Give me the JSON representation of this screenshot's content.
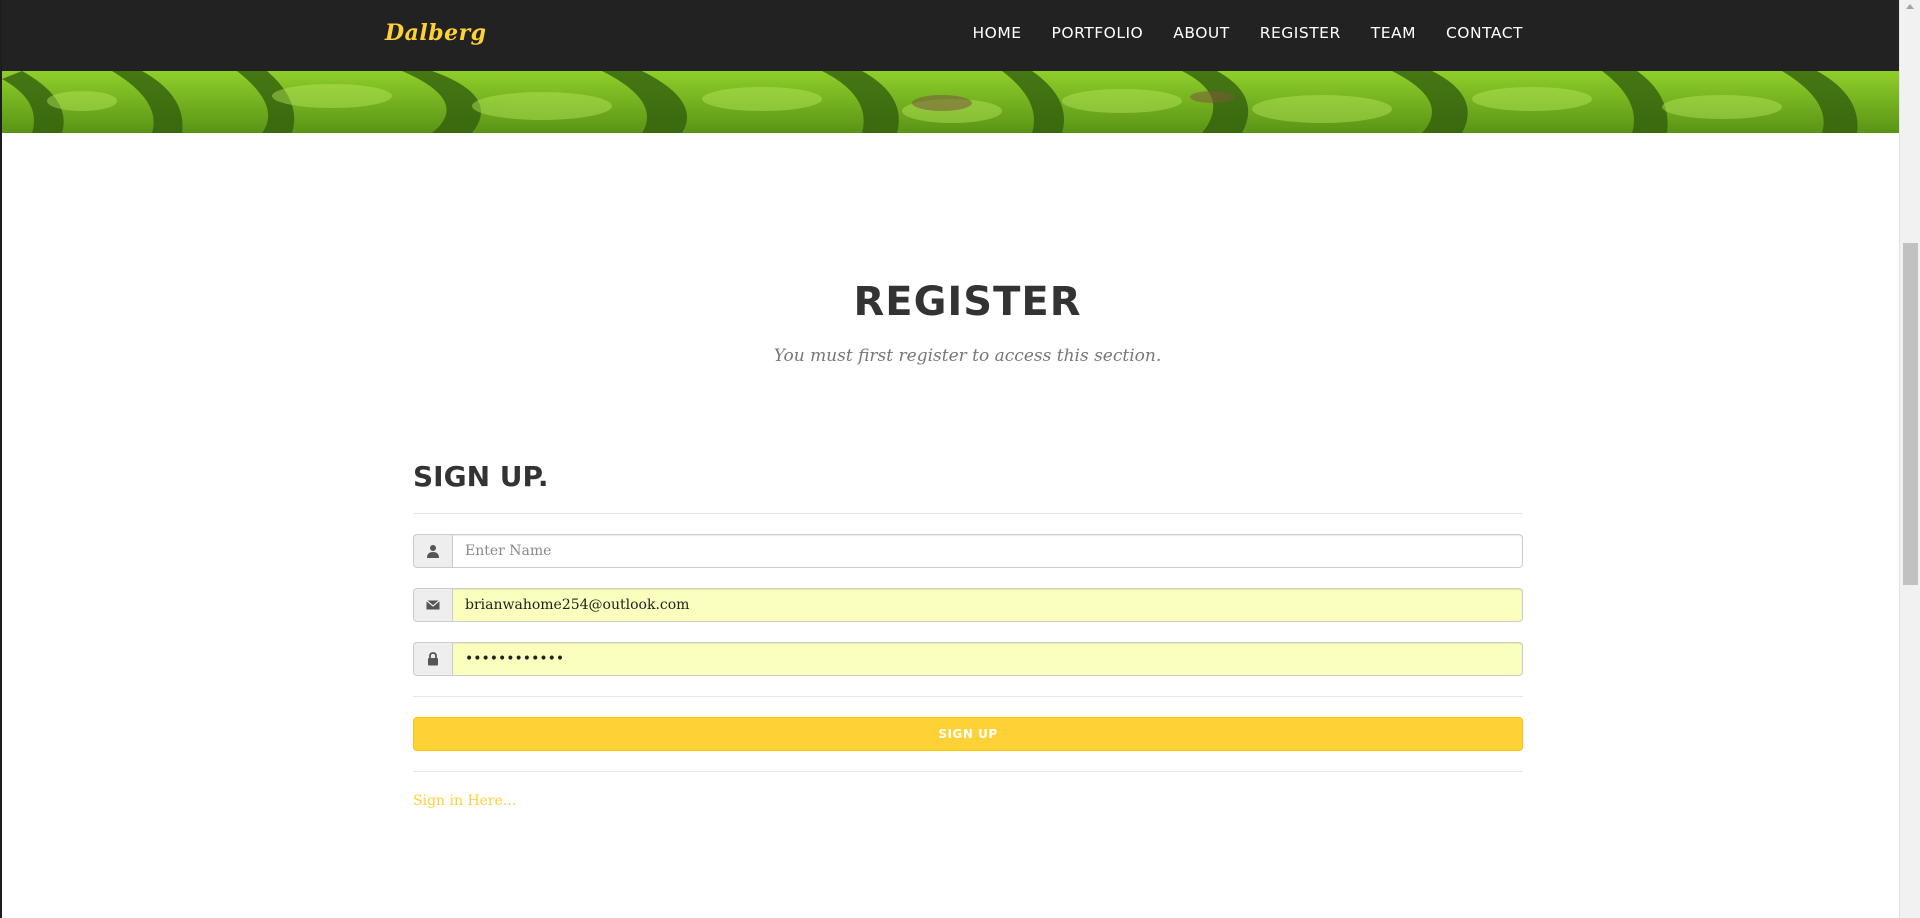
{
  "header": {
    "brand": "Dalberg",
    "nav": [
      "HOME",
      "PORTFOLIO",
      "ABOUT",
      "REGISTER",
      "TEAM",
      "CONTACT"
    ]
  },
  "section": {
    "title": "REGISTER",
    "subtitle": "You must first register to access this section."
  },
  "form": {
    "heading": "SIGN UP.",
    "name": {
      "icon": "user-icon",
      "placeholder": "Enter Name",
      "value": ""
    },
    "email": {
      "icon": "envelope-icon",
      "value": "brianwahome254@outlook.com"
    },
    "password": {
      "icon": "lock-icon",
      "value": "••••••••••••"
    },
    "submit_label": "SIGN UP",
    "signin_link": "Sign in Here..."
  },
  "colors": {
    "navbar_bg": "#222222",
    "accent": "#fed136",
    "autofill_bg": "#faffbd"
  }
}
